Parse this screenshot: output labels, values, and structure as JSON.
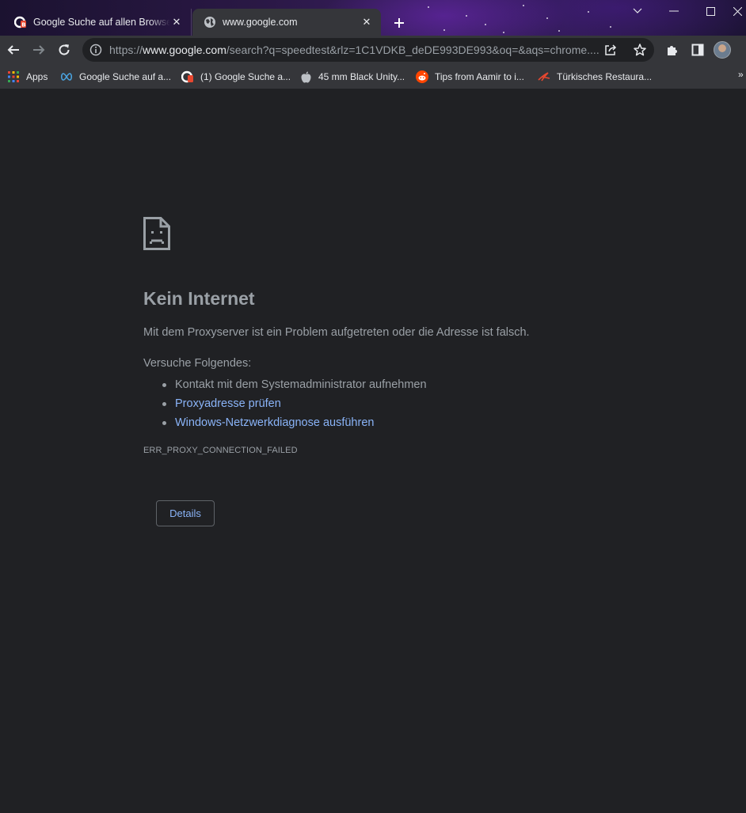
{
  "tabs": [
    {
      "title": "Google Suche auf allen Browser s",
      "favicon": "cb-logo-icon",
      "active": false,
      "close": "✕"
    },
    {
      "title": "www.google.com",
      "favicon": "globe-icon",
      "active": true,
      "close": "✕"
    }
  ],
  "new_tab_label": "+",
  "window_controls": [
    "chevron-down-icon",
    "minimize-icon",
    "maximize-icon",
    "close-icon"
  ],
  "address": {
    "scheme": "https://",
    "host": "www.google.com",
    "path": "/search?q=speedtest&rlz=1C1VDKB_deDE993DE993&oq=&aqs=chrome...."
  },
  "bookmarks": [
    {
      "label": "Apps",
      "icon": "apps-grid-icon"
    },
    {
      "label": "Google Suche auf a...",
      "icon": "infinity-icon"
    },
    {
      "label": "(1) Google Suche a...",
      "icon": "cb-logo-icon"
    },
    {
      "label": "45 mm Black Unity...",
      "icon": "apple-icon"
    },
    {
      "label": "Tips from Aamir to i...",
      "icon": "reddit-icon"
    },
    {
      "label": "Türkisches Restaura...",
      "icon": "bird-icon"
    }
  ],
  "bookmarks_overflow": "»",
  "error": {
    "title": "Kein Internet",
    "message": "Mit dem Proxyserver ist ein Problem aufgetreten oder die Adresse ist falsch.",
    "try_heading": "Versuche Folgendes:",
    "suggestions": [
      {
        "text": "Kontakt mit dem Systemadministrator aufnehmen",
        "link": false
      },
      {
        "text": "Proxyadresse prüfen",
        "link": true
      },
      {
        "text": "Windows-Netzwerkdiagnose ausführen",
        "link": true
      }
    ],
    "code": "ERR_PROXY_CONNECTION_FAILED",
    "details_button": "Details"
  },
  "colors": {
    "page_bg": "#202124",
    "toolbar_bg": "#35363a",
    "link": "#8ab4f8",
    "secondary_text": "#9aa0a6"
  }
}
